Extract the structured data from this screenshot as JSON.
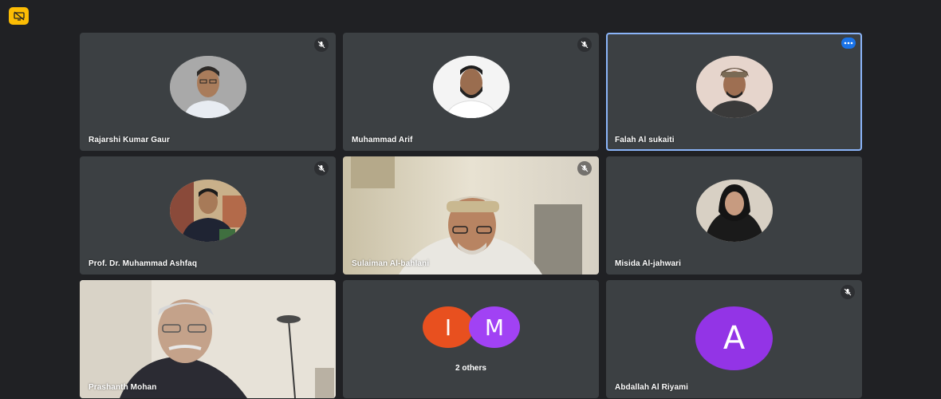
{
  "toolbar": {
    "presentation_icon": "presentation-off-icon"
  },
  "accent_colors": {
    "active_border": "#8ab4f8",
    "more_button": "#1a73e8",
    "present_button": "#fbbc04",
    "avatar_I": "#e8501f",
    "avatar_M": "#a142f4",
    "avatar_A": "#9334e6"
  },
  "participants": [
    {
      "name": "Rajarshi Kumar Gaur",
      "muted": true
    },
    {
      "name": "Muhammad Arif",
      "muted": true
    },
    {
      "name": "Falah Al sukaiti",
      "muted": false,
      "active_speaker": true
    },
    {
      "name": "Prof. Dr. Muhammad Ashfaq",
      "muted": true
    },
    {
      "name": "Sulaiman Al-bahlani",
      "muted": true
    },
    {
      "name": "Misida Al-jahwari",
      "muted": false
    },
    {
      "name": "Prashanth Mohan",
      "muted": false
    },
    {
      "others_label": "2 others",
      "initials": [
        "I",
        "M"
      ]
    },
    {
      "name": "Abdallah Al Riyami",
      "initial": "A",
      "muted": true
    }
  ]
}
